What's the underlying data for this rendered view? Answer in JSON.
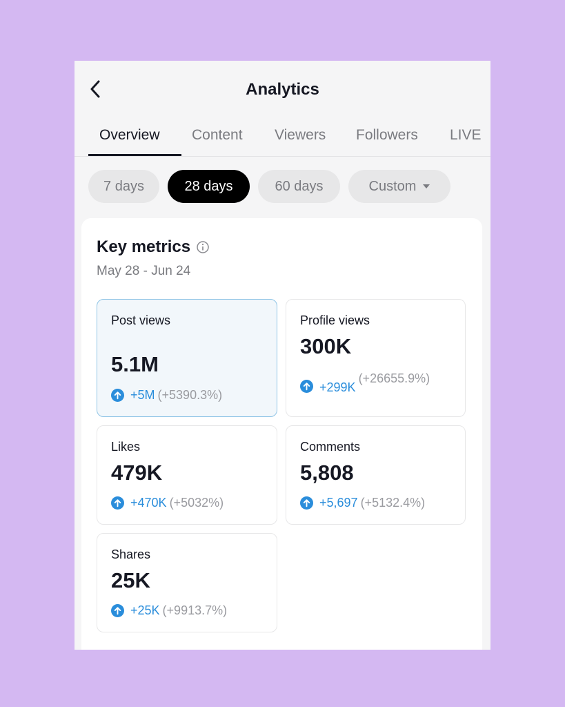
{
  "header": {
    "title": "Analytics",
    "back_icon": "chevron-left-icon"
  },
  "tabs": [
    {
      "label": "Overview",
      "active": true
    },
    {
      "label": "Content",
      "active": false
    },
    {
      "label": "Viewers",
      "active": false
    },
    {
      "label": "Followers",
      "active": false
    },
    {
      "label": "LIVE",
      "active": false
    }
  ],
  "date_filters": [
    {
      "label": "7 days",
      "active": false
    },
    {
      "label": "28 days",
      "active": true
    },
    {
      "label": "60 days",
      "active": false
    },
    {
      "label": "Custom",
      "active": false,
      "icon": "caret-down-icon"
    }
  ],
  "key_metrics": {
    "title": "Key metrics",
    "info_icon": "info-icon",
    "date_range": "May 28 - Jun 24",
    "cards": [
      {
        "label": "Post views",
        "value": "5.1M",
        "delta": "+5M",
        "delta_pct": "(+5390.3%)",
        "selected": true
      },
      {
        "label": "Profile views",
        "value": "300K",
        "delta": "+299K",
        "delta_pct": "(+26655.9%)",
        "selected": false
      },
      {
        "label": "Likes",
        "value": "479K",
        "delta": "+470K",
        "delta_pct": "(+5032%)",
        "selected": false
      },
      {
        "label": "Comments",
        "value": "5,808",
        "delta": "+5,697",
        "delta_pct": "(+5132.4%)",
        "selected": false
      },
      {
        "label": "Shares",
        "value": "25K",
        "delta": "+25K",
        "delta_pct": "(+9913.7%)",
        "selected": false
      }
    ]
  },
  "colors": {
    "page_background": "#d4b8f2",
    "accent_blue": "#2a8ddb",
    "active_chip": "#000000",
    "selected_card_bg": "#f2f7fb",
    "selected_card_border": "#8fc4e6"
  }
}
